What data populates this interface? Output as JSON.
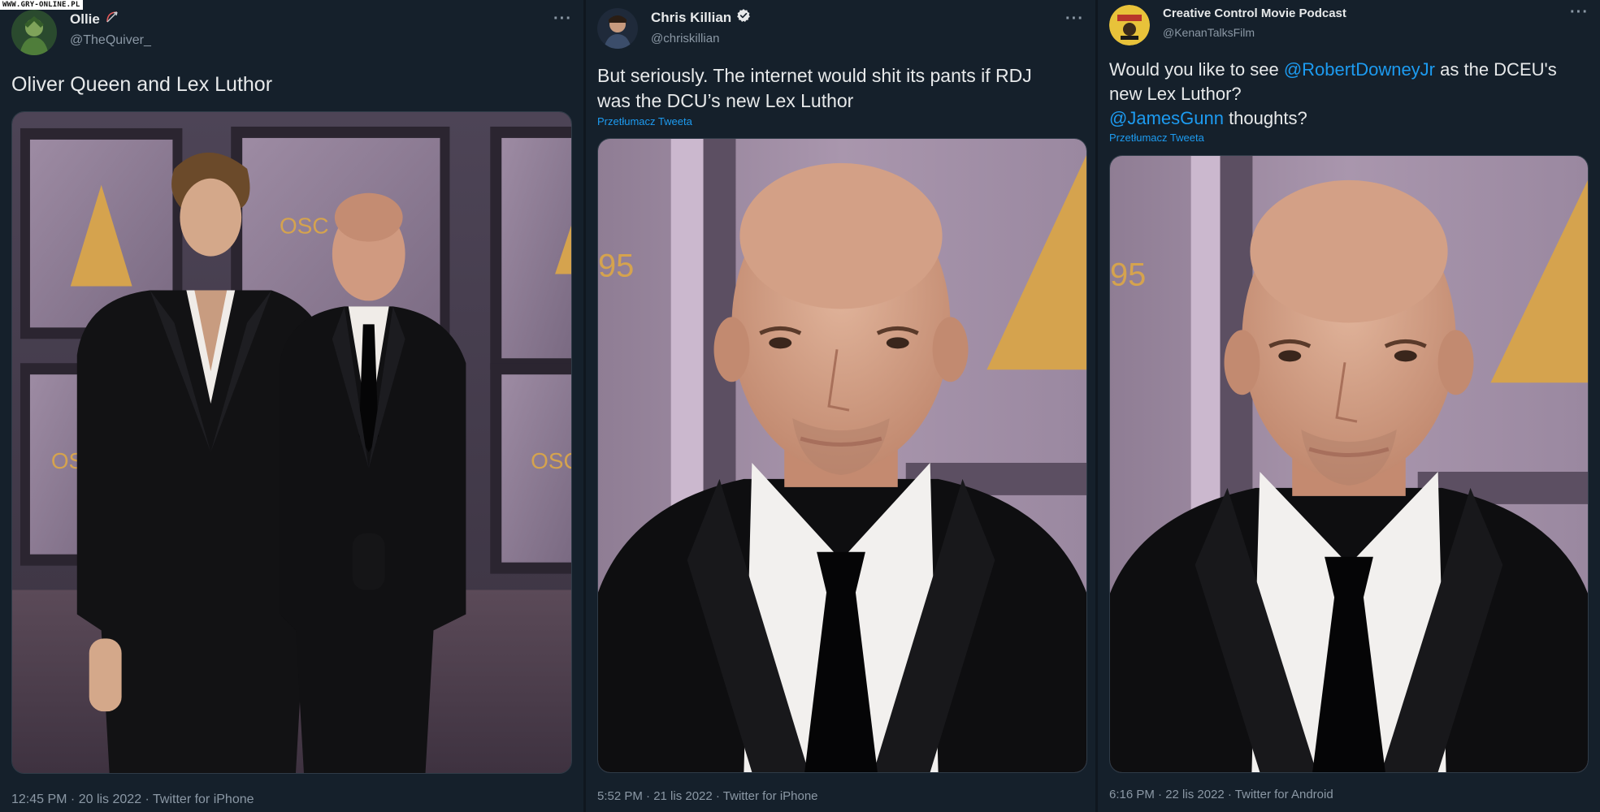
{
  "watermark": "WWW.GRY-ONLINE.PL",
  "tweets": [
    {
      "name": "Ollie",
      "handle": "@TheQuiver_",
      "text": "Oliver Queen and Lex Luthor",
      "more": "···",
      "timestamp": "12:45 PM · 20 lis 2022 · Twitter for iPhone",
      "name_icon": "bow-arrow-icon",
      "photo": "two-men-in-black-suits-at-oscars-event"
    },
    {
      "name": "Chris Killian",
      "handle": "@chriskillian",
      "text_line1": "But seriously. The internet would shit its pants if RDJ",
      "text_line2": "was the DCU’s new Lex Luthor",
      "translate": "Przetłumacz Tweeta",
      "more": "···",
      "timestamp": "5:52 PM · 21 lis 2022 · Twitter for iPhone",
      "name_icon": "verified-icon",
      "photo": "bald-man-in-suit-closeup"
    },
    {
      "name": "Creative Control Movie Podcast",
      "handle": "@KenanTalksFilm",
      "text_part1": "Would you like to see ",
      "mention1": "@RobertDowneyJr",
      "text_part2": " as the DCEU's",
      "text_line2": "new Lex Luthor?",
      "mention2": "@JamesGunn",
      "text_part3": " thoughts?",
      "translate": "Przetłumacz Tweeta",
      "more": "···",
      "timestamp": "6:16 PM · 22 lis 2022 · Twitter for Android",
      "photo": "bald-man-in-suit-closeup"
    }
  ],
  "colors": {
    "background": "#15202b",
    "link": "#1d9bf0",
    "muted": "#8b98a5",
    "text": "#e7e9ea"
  }
}
